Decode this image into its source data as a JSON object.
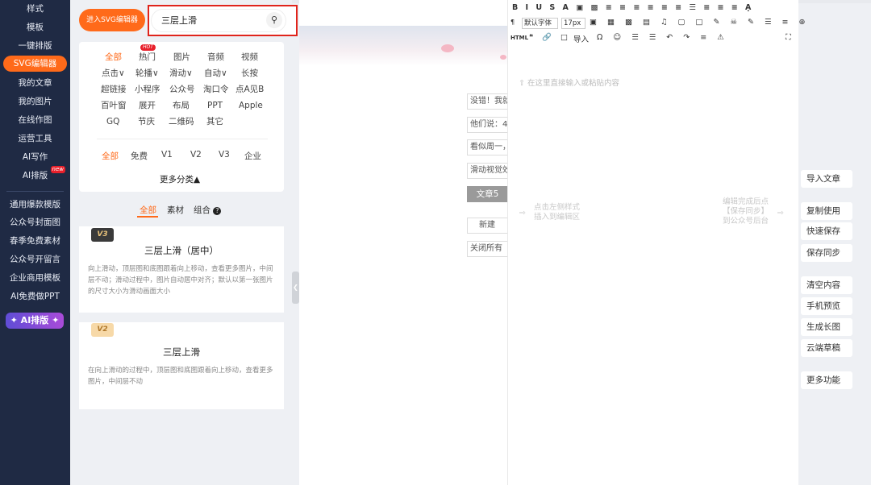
{
  "sidebar": {
    "items": [
      "样式",
      "模板",
      "一键排版",
      "SVG编辑器",
      "我的文章",
      "我的图片",
      "在线作图",
      "运营工具",
      "AI写作",
      "AI排版",
      "通用爆款模版",
      "公众号封面图",
      "春季免费素材",
      "公众号开留言",
      "企业商用模板",
      "AI免费做PPT"
    ],
    "new_badge": "new",
    "ai_button": "✦ AI排版 ✦"
  },
  "panel": {
    "enter_svg": "进入SVG编辑器",
    "search_value": "三层上滑",
    "categories": [
      "全部",
      "热门",
      "图片",
      "音频",
      "视频",
      "点击∨",
      "轮播∨",
      "滑动∨",
      "自动∨",
      "长按",
      "超链接",
      "小程序",
      "公众号",
      "淘口令",
      "点A见B",
      "百叶窗",
      "展开",
      "布局",
      "PPT",
      "Apple",
      "GQ",
      "节庆",
      "二维码",
      "其它"
    ],
    "hot_badge": "HOT",
    "tiers": [
      "全部",
      "免费",
      "V1",
      "V2",
      "V3",
      "企业"
    ],
    "more": "更多分类▲",
    "subtabs": [
      "全部",
      "素材",
      "组合"
    ],
    "templates": [
      {
        "badge": "V3",
        "title": "三层上滑（居中）",
        "desc": "向上滑动，顶层图和底图跟着向上移动，查看更多图片，中间层不动；滑动过程中，图片自动居中对齐；默认以第一张图片的尺寸大小为滑动画面大小"
      },
      {
        "badge": "V2",
        "title": "三层上滑",
        "desc": "在向上滑动的过程中，顶层图和底图跟着向上移动，查看更多图片，中间层不动"
      }
    ]
  },
  "preview": {
    "rows": [
      "没错！我就",
      "他们说：4.",
      "看似周一，",
      "滑动视觉效"
    ],
    "article_tab": "文章5",
    "new_btn": "新建",
    "close_all": "关闭所有"
  },
  "editor": {
    "placeholder": "在这里直接输入或粘贴内容",
    "font": "默认字体",
    "size": "17px",
    "import": "导入",
    "hint_left": "点击左侧样式\n插入到编辑区",
    "hint_right": "编辑完成后点\n【保存同步】\n到公众号后台"
  },
  "actions": [
    "导入文章",
    "复制使用",
    "快速保存",
    "保存同步",
    "清空内容",
    "手机预览",
    "生成长图",
    "云端草稿",
    "更多功能"
  ]
}
